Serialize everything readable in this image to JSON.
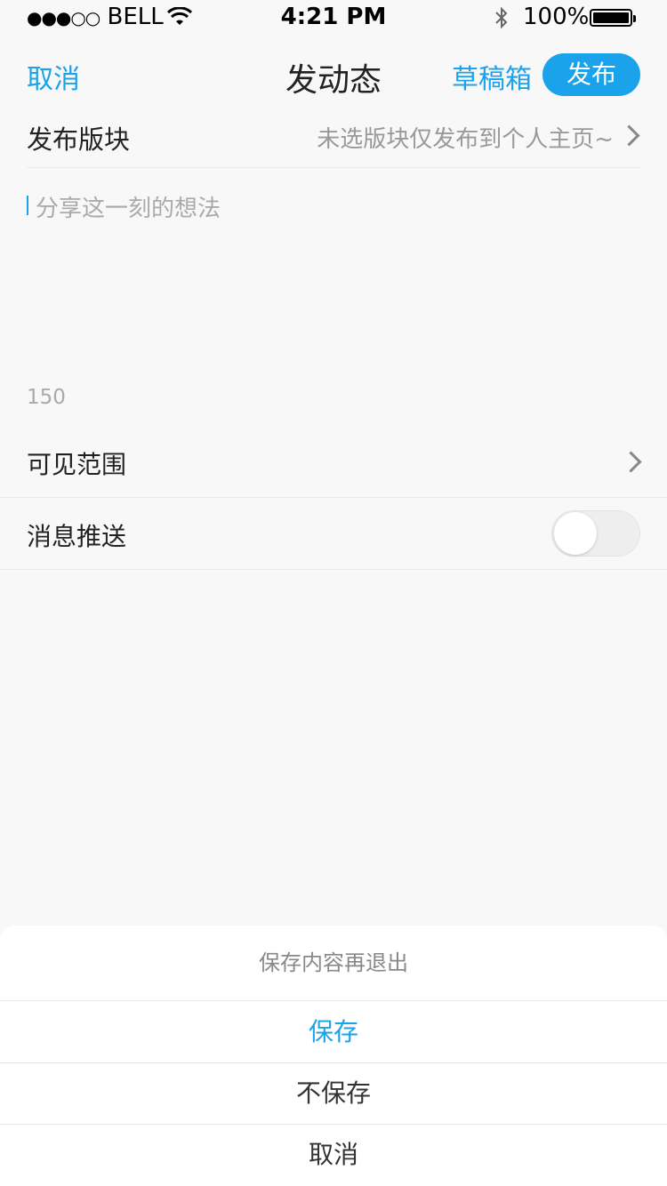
{
  "status_bar": {
    "carrier": "BELL",
    "signal_dots": "●●●○○",
    "time": "4:21 PM",
    "battery": "100%"
  },
  "nav": {
    "cancel": "取消",
    "title": "发动态",
    "drafts": "草稿箱",
    "publish": "发布"
  },
  "section": {
    "label": "发布版块",
    "value": "未选版块仅发布到个人主页~"
  },
  "composer": {
    "placeholder": "分享这一刻的想法",
    "char_count": "150"
  },
  "settings": {
    "visibility_label": "可见范围",
    "push_label": "消息推送",
    "push_enabled": false
  },
  "action_sheet": {
    "title": "保存内容再退出",
    "save": "保存",
    "dont_save": "不保存",
    "cancel": "取消"
  },
  "colors": {
    "accent": "#1aa3ea",
    "background": "#f8f8f8"
  }
}
